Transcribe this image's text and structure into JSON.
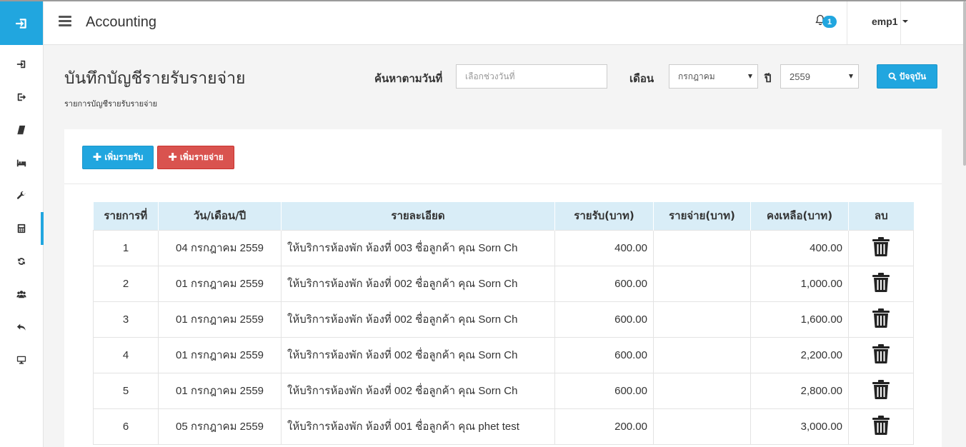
{
  "app": {
    "title": "Accounting"
  },
  "header": {
    "notification_count": "1",
    "user": "emp1"
  },
  "sidebar": {
    "brand_icon": "sign-in-icon",
    "items": [
      {
        "icon": "sign-in-icon"
      },
      {
        "icon": "sign-out-icon"
      },
      {
        "icon": "book-icon"
      },
      {
        "icon": "bed-icon"
      },
      {
        "icon": "wrench-icon"
      },
      {
        "icon": "calculator-icon",
        "active": true
      },
      {
        "icon": "refresh-icon"
      },
      {
        "icon": "users-icon"
      },
      {
        "icon": "reply-icon"
      },
      {
        "icon": "desktop-icon"
      }
    ]
  },
  "page": {
    "title": "บันทึกบัญชีรายรับรายจ่าย",
    "subtitle": "รายการบัญชีรายรับรายจ่าย"
  },
  "filters": {
    "search_label": "ค้นหาตามวันที่",
    "date_placeholder": "เลือกช่วงวันที่",
    "month_label": "เดือน",
    "month_value": "กรกฎาคม",
    "year_label": "ปี",
    "year_value": "2559",
    "current_button": "ปัจจุบัน"
  },
  "actions": {
    "add_income": "เพิ่มรายรับ",
    "add_expense": "เพิ่มรายจ่าย"
  },
  "table": {
    "columns": [
      "รายการที่",
      "วัน/เดือน/ปี",
      "รายละเอียด",
      "รายรับ(บาท)",
      "รายจ่าย(บาท)",
      "คงเหลือ(บาท)",
      "ลบ"
    ],
    "rows": [
      {
        "no": "1",
        "date": "04 กรกฎาคม 2559",
        "detail": "ให้บริการห้องพัก ห้องที่ 003 ชื่อลูกค้า คุณ Sorn Ch",
        "income": "400.00",
        "expense": "",
        "balance": "400.00"
      },
      {
        "no": "2",
        "date": "01 กรกฎาคม 2559",
        "detail": "ให้บริการห้องพัก ห้องที่ 002 ชื่อลูกค้า คุณ Sorn Ch",
        "income": "600.00",
        "expense": "",
        "balance": "1,000.00"
      },
      {
        "no": "3",
        "date": "01 กรกฎาคม 2559",
        "detail": "ให้บริการห้องพัก ห้องที่ 002 ชื่อลูกค้า คุณ Sorn Ch",
        "income": "600.00",
        "expense": "",
        "balance": "1,600.00"
      },
      {
        "no": "4",
        "date": "01 กรกฎาคม 2559",
        "detail": "ให้บริการห้องพัก ห้องที่ 002 ชื่อลูกค้า คุณ Sorn Ch",
        "income": "600.00",
        "expense": "",
        "balance": "2,200.00"
      },
      {
        "no": "5",
        "date": "01 กรกฎาคม 2559",
        "detail": "ให้บริการห้องพัก ห้องที่ 002 ชื่อลูกค้า คุณ Sorn Ch",
        "income": "600.00",
        "expense": "",
        "balance": "2,800.00"
      },
      {
        "no": "6",
        "date": "05 กรกฎาคม 2559",
        "detail": "ให้บริการห้องพัก ห้องที่ 001 ชื่อลูกค้า คุณ phet test",
        "income": "200.00",
        "expense": "",
        "balance": "3,000.00"
      }
    ]
  },
  "colors": {
    "accent": "#21a6df",
    "danger": "#d9534f",
    "table_header": "#d9edf7"
  }
}
